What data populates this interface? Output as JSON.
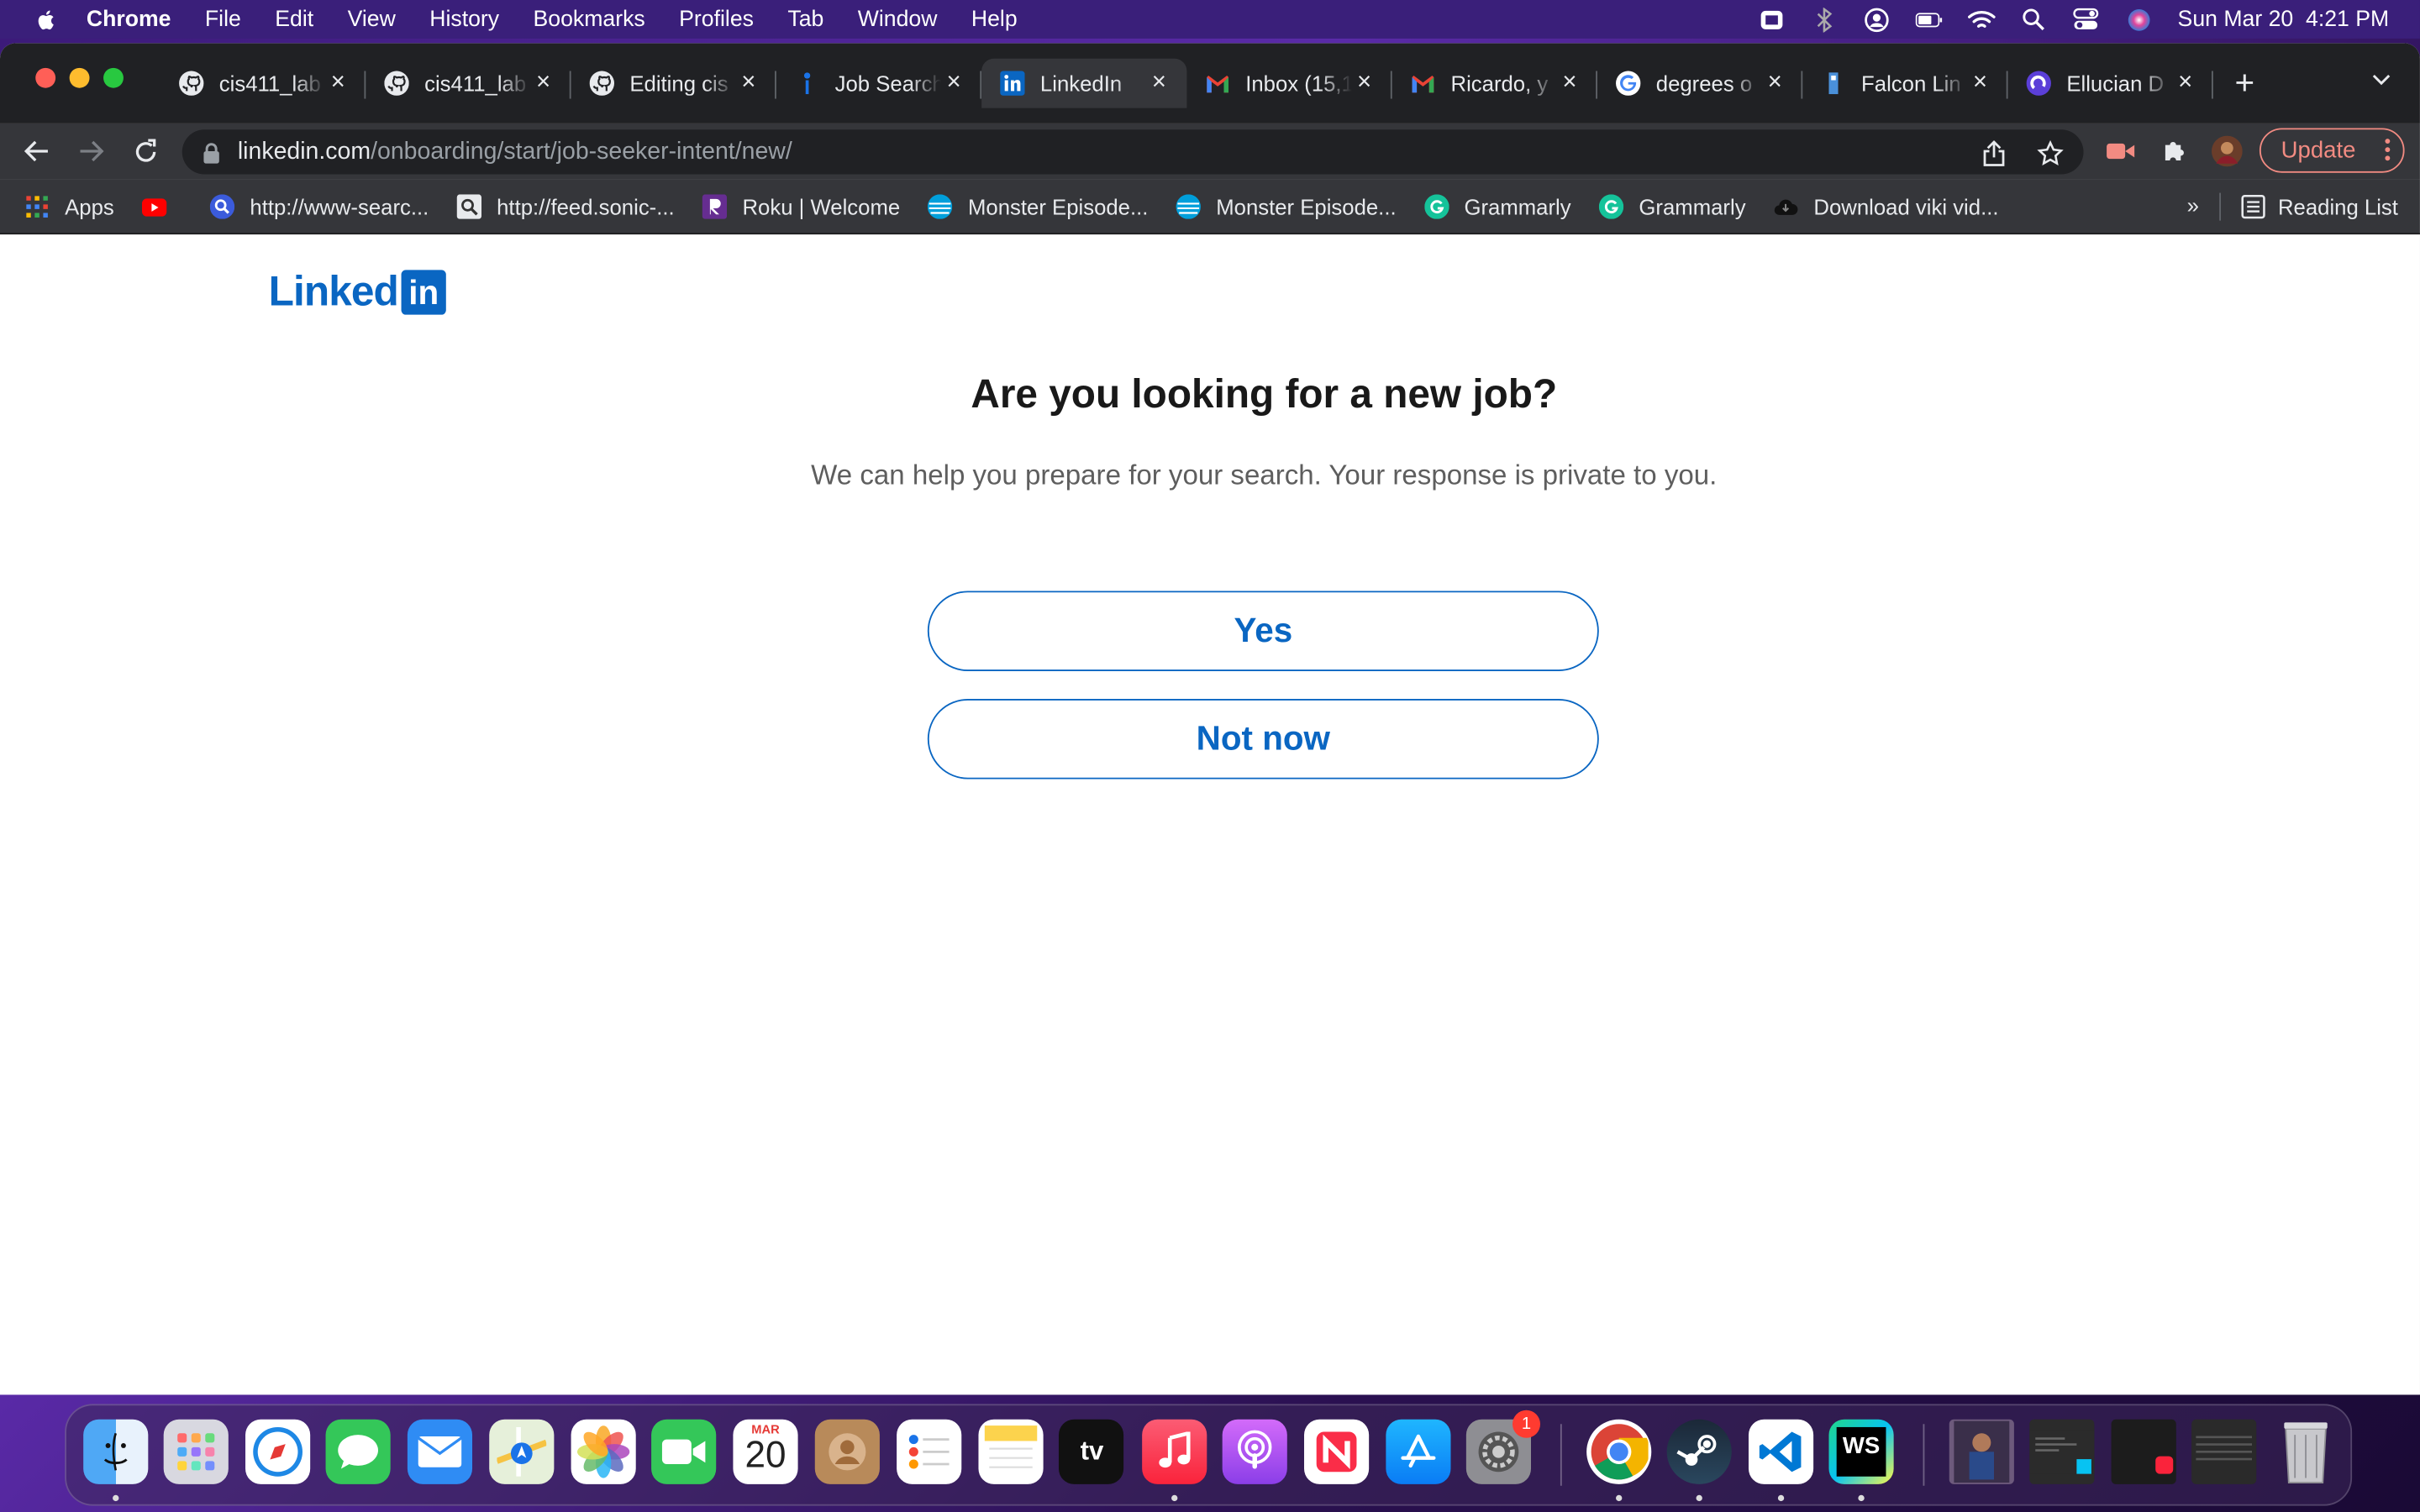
{
  "menubar": {
    "app_name": "Chrome",
    "items": [
      "File",
      "Edit",
      "View",
      "History",
      "Bookmarks",
      "Profiles",
      "Tab",
      "Window",
      "Help"
    ],
    "clock": "Sun Mar 20  4:21 PM"
  },
  "tabs": [
    {
      "title": "cis411_lab",
      "icon": "github-icon",
      "active": false
    },
    {
      "title": "cis411_lab",
      "icon": "github-icon",
      "active": false
    },
    {
      "title": "Editing cis",
      "icon": "github-icon",
      "active": false
    },
    {
      "title": "Job Search",
      "icon": "job-search-icon",
      "active": false
    },
    {
      "title": "LinkedIn",
      "icon": "linkedin-icon",
      "active": true
    },
    {
      "title": "Inbox (15,1",
      "icon": "gmail-icon",
      "active": false
    },
    {
      "title": "Ricardo, y",
      "icon": "gmail-icon",
      "active": false
    },
    {
      "title": "degrees o",
      "icon": "google-icon",
      "active": false
    },
    {
      "title": "Falcon Lin",
      "icon": "falcon-icon",
      "active": false
    },
    {
      "title": "Ellucian D",
      "icon": "ellucian-icon",
      "active": false
    }
  ],
  "address": {
    "host": "linkedin.com",
    "path": "/onboarding/start/job-seeker-intent/new/"
  },
  "update_label": "Update",
  "bookmarks": [
    {
      "label": "Apps",
      "icon": "apps-grid-icon"
    },
    {
      "label": "",
      "icon": "youtube-icon"
    },
    {
      "label": "http://www-searc...",
      "icon": "search-site-icon"
    },
    {
      "label": "http://feed.sonic-...",
      "icon": "magnifier-icon"
    },
    {
      "label": "Roku | Welcome",
      "icon": "roku-icon"
    },
    {
      "label": "Monster Episode...",
      "icon": "att-globe-icon"
    },
    {
      "label": "Monster Episode...",
      "icon": "att-globe-icon"
    },
    {
      "label": "Grammarly",
      "icon": "grammarly-icon"
    },
    {
      "label": "Grammarly",
      "icon": "grammarly-icon"
    },
    {
      "label": "Download viki vid...",
      "icon": "cloud-icon"
    }
  ],
  "bookmarks_more": "»",
  "reading_list": "Reading List",
  "page": {
    "logo_word": "Linked",
    "logo_box": "in",
    "heading": "Are you looking for a new job?",
    "subtext": "We can help you prepare for your search. Your response is private to you.",
    "yes_label": "Yes",
    "not_now_label": "Not now"
  },
  "dock": {
    "calendar_month": "MAR",
    "calendar_day": "20",
    "settings_badge": "1",
    "tv_label": "tv",
    "ws_label": "WS"
  },
  "colors": {
    "linkedin_blue": "#0a66c2",
    "heading": "#191919",
    "subtext": "#5e5e5e"
  }
}
